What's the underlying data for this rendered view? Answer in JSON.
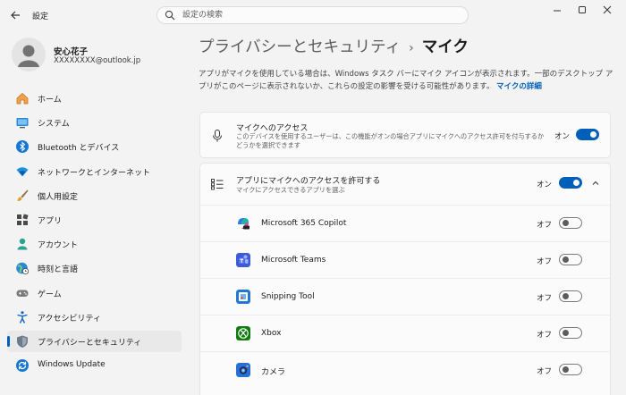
{
  "window": {
    "title": "設定"
  },
  "search": {
    "placeholder": "設定の検索"
  },
  "profile": {
    "name": "安心花子",
    "email": "XXXXXXXX@outlook.jp"
  },
  "nav": {
    "items": [
      {
        "label": "ホーム",
        "icon": "home-icon"
      },
      {
        "label": "システム",
        "icon": "system-icon"
      },
      {
        "label": "Bluetooth とデバイス",
        "icon": "bluetooth-icon"
      },
      {
        "label": "ネットワークとインターネット",
        "icon": "wifi-icon"
      },
      {
        "label": "個人用設定",
        "icon": "brush-icon"
      },
      {
        "label": "アプリ",
        "icon": "apps-icon"
      },
      {
        "label": "アカウント",
        "icon": "account-icon"
      },
      {
        "label": "時刻と言語",
        "icon": "globe-clock-icon"
      },
      {
        "label": "ゲーム",
        "icon": "gamepad-icon"
      },
      {
        "label": "アクセシビリティ",
        "icon": "accessibility-icon"
      },
      {
        "label": "プライバシーとセキュリティ",
        "icon": "shield-icon",
        "active": true
      },
      {
        "label": "Windows Update",
        "icon": "update-icon"
      }
    ]
  },
  "breadcrumb": {
    "parent": "プライバシーとセキュリティ",
    "separator": "›",
    "current": "マイク"
  },
  "description": {
    "text": "アプリがマイクを使用している場合は、Windows タスク バーにマイク アイコンが表示されます。一部のデスクトップ アプリがこのページに表示されないか、これらの設定の影響を受ける可能性があります。",
    "link": "マイクの詳細"
  },
  "mic_access": {
    "title": "マイクへのアクセス",
    "subtitle": "このデバイスを使用するユーザーは、この機能がオンの場合アプリにマイクへのアクセス許可を付与するかどうかを選択できます",
    "state": "オン",
    "on": true
  },
  "app_access": {
    "title": "アプリにマイクへのアクセスを許可する",
    "subtitle": "マイクにアクセスできるアプリを選ぶ",
    "state": "オン",
    "on": true
  },
  "apps": [
    {
      "name": "Microsoft 365 Copilot",
      "state": "オフ",
      "icon": "copilot-icon"
    },
    {
      "name": "Microsoft Teams",
      "state": "オフ",
      "icon": "teams-icon"
    },
    {
      "name": "Snipping Tool",
      "state": "オフ",
      "icon": "snipping-tool-icon"
    },
    {
      "name": "Xbox",
      "state": "オフ",
      "icon": "xbox-icon"
    },
    {
      "name": "カメラ",
      "state": "オフ",
      "icon": "camera-icon"
    }
  ],
  "colors": {
    "accent": "#005fb8",
    "background": "#f3f3f3",
    "card": "#fbfbfb"
  }
}
